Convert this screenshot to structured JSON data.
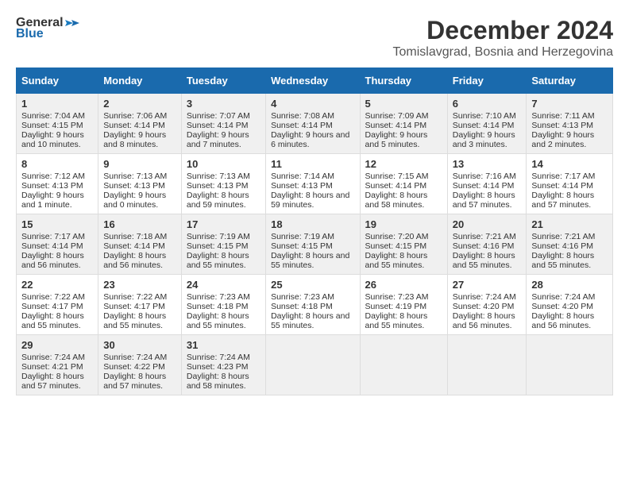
{
  "logo": {
    "general": "General",
    "blue": "Blue"
  },
  "title": "December 2024",
  "subtitle": "Tomislavgrad, Bosnia and Herzegovina",
  "days_header": [
    "Sunday",
    "Monday",
    "Tuesday",
    "Wednesday",
    "Thursday",
    "Friday",
    "Saturday"
  ],
  "weeks": [
    [
      {
        "day": "1",
        "info": "Sunrise: 7:04 AM\nSunset: 4:15 PM\nDaylight: 9 hours and 10 minutes."
      },
      {
        "day": "2",
        "info": "Sunrise: 7:06 AM\nSunset: 4:14 PM\nDaylight: 9 hours and 8 minutes."
      },
      {
        "day": "3",
        "info": "Sunrise: 7:07 AM\nSunset: 4:14 PM\nDaylight: 9 hours and 7 minutes."
      },
      {
        "day": "4",
        "info": "Sunrise: 7:08 AM\nSunset: 4:14 PM\nDaylight: 9 hours and 6 minutes."
      },
      {
        "day": "5",
        "info": "Sunrise: 7:09 AM\nSunset: 4:14 PM\nDaylight: 9 hours and 5 minutes."
      },
      {
        "day": "6",
        "info": "Sunrise: 7:10 AM\nSunset: 4:14 PM\nDaylight: 9 hours and 3 minutes."
      },
      {
        "day": "7",
        "info": "Sunrise: 7:11 AM\nSunset: 4:13 PM\nDaylight: 9 hours and 2 minutes."
      }
    ],
    [
      {
        "day": "8",
        "info": "Sunrise: 7:12 AM\nSunset: 4:13 PM\nDaylight: 9 hours and 1 minute."
      },
      {
        "day": "9",
        "info": "Sunrise: 7:13 AM\nSunset: 4:13 PM\nDaylight: 9 hours and 0 minutes."
      },
      {
        "day": "10",
        "info": "Sunrise: 7:13 AM\nSunset: 4:13 PM\nDaylight: 8 hours and 59 minutes."
      },
      {
        "day": "11",
        "info": "Sunrise: 7:14 AM\nSunset: 4:13 PM\nDaylight: 8 hours and 59 minutes."
      },
      {
        "day": "12",
        "info": "Sunrise: 7:15 AM\nSunset: 4:14 PM\nDaylight: 8 hours and 58 minutes."
      },
      {
        "day": "13",
        "info": "Sunrise: 7:16 AM\nSunset: 4:14 PM\nDaylight: 8 hours and 57 minutes."
      },
      {
        "day": "14",
        "info": "Sunrise: 7:17 AM\nSunset: 4:14 PM\nDaylight: 8 hours and 57 minutes."
      }
    ],
    [
      {
        "day": "15",
        "info": "Sunrise: 7:17 AM\nSunset: 4:14 PM\nDaylight: 8 hours and 56 minutes."
      },
      {
        "day": "16",
        "info": "Sunrise: 7:18 AM\nSunset: 4:14 PM\nDaylight: 8 hours and 56 minutes."
      },
      {
        "day": "17",
        "info": "Sunrise: 7:19 AM\nSunset: 4:15 PM\nDaylight: 8 hours and 55 minutes."
      },
      {
        "day": "18",
        "info": "Sunrise: 7:19 AM\nSunset: 4:15 PM\nDaylight: 8 hours and 55 minutes."
      },
      {
        "day": "19",
        "info": "Sunrise: 7:20 AM\nSunset: 4:15 PM\nDaylight: 8 hours and 55 minutes."
      },
      {
        "day": "20",
        "info": "Sunrise: 7:21 AM\nSunset: 4:16 PM\nDaylight: 8 hours and 55 minutes."
      },
      {
        "day": "21",
        "info": "Sunrise: 7:21 AM\nSunset: 4:16 PM\nDaylight: 8 hours and 55 minutes."
      }
    ],
    [
      {
        "day": "22",
        "info": "Sunrise: 7:22 AM\nSunset: 4:17 PM\nDaylight: 8 hours and 55 minutes."
      },
      {
        "day": "23",
        "info": "Sunrise: 7:22 AM\nSunset: 4:17 PM\nDaylight: 8 hours and 55 minutes."
      },
      {
        "day": "24",
        "info": "Sunrise: 7:23 AM\nSunset: 4:18 PM\nDaylight: 8 hours and 55 minutes."
      },
      {
        "day": "25",
        "info": "Sunrise: 7:23 AM\nSunset: 4:18 PM\nDaylight: 8 hours and 55 minutes."
      },
      {
        "day": "26",
        "info": "Sunrise: 7:23 AM\nSunset: 4:19 PM\nDaylight: 8 hours and 55 minutes."
      },
      {
        "day": "27",
        "info": "Sunrise: 7:24 AM\nSunset: 4:20 PM\nDaylight: 8 hours and 56 minutes."
      },
      {
        "day": "28",
        "info": "Sunrise: 7:24 AM\nSunset: 4:20 PM\nDaylight: 8 hours and 56 minutes."
      }
    ],
    [
      {
        "day": "29",
        "info": "Sunrise: 7:24 AM\nSunset: 4:21 PM\nDaylight: 8 hours and 57 minutes."
      },
      {
        "day": "30",
        "info": "Sunrise: 7:24 AM\nSunset: 4:22 PM\nDaylight: 8 hours and 57 minutes."
      },
      {
        "day": "31",
        "info": "Sunrise: 7:24 AM\nSunset: 4:23 PM\nDaylight: 8 hours and 58 minutes."
      },
      {
        "day": "",
        "info": ""
      },
      {
        "day": "",
        "info": ""
      },
      {
        "day": "",
        "info": ""
      },
      {
        "day": "",
        "info": ""
      }
    ]
  ]
}
